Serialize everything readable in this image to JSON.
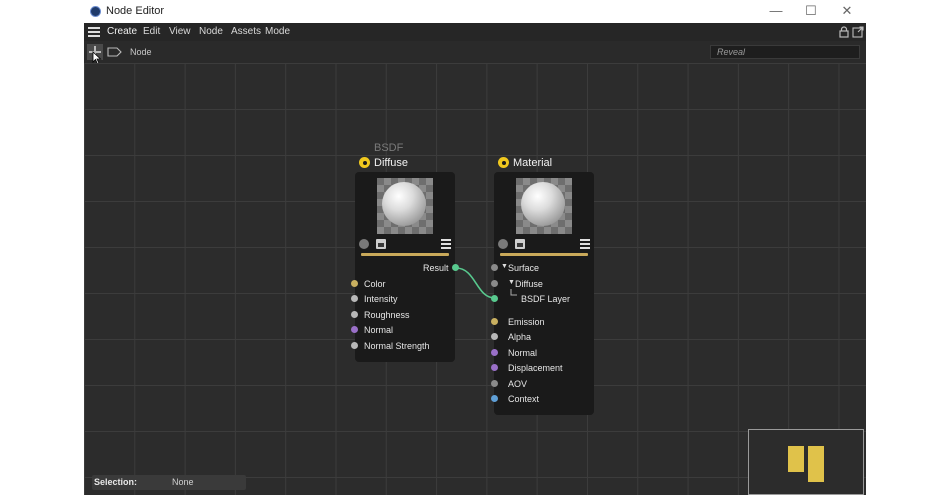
{
  "window": {
    "title": "Node Editor",
    "controls": {
      "minimize": "—",
      "maximize": "☐",
      "close": "✕"
    }
  },
  "menubar": {
    "items": [
      "Create",
      "Edit",
      "View",
      "Node",
      "Assets",
      "Mode"
    ],
    "active": "Create"
  },
  "toolbar": {
    "node_label": "Node",
    "reveal_placeholder": "Reveal"
  },
  "nodes": {
    "diffuse": {
      "group": "BSDF",
      "title": "Diffuse",
      "output": "Result",
      "inputs": [
        "Color",
        "Intensity",
        "Roughness",
        "Normal",
        "Normal Strength"
      ]
    },
    "material": {
      "title": "Material",
      "surface": "Surface",
      "diffuse": "Diffuse",
      "bsdf_layer": "BSDF Layer",
      "inputs": [
        "Emission",
        "Alpha",
        "Normal",
        "Displacement",
        "AOV",
        "Context"
      ]
    }
  },
  "port_colors": {
    "color": "#c9b060",
    "float": "#b8b8b8",
    "vector": "#9a70c8",
    "surface": "#8a8a8a",
    "bsdf": "#58c98e",
    "context": "#5f9fd6"
  },
  "status": {
    "label": "Selection:",
    "value": "None"
  }
}
